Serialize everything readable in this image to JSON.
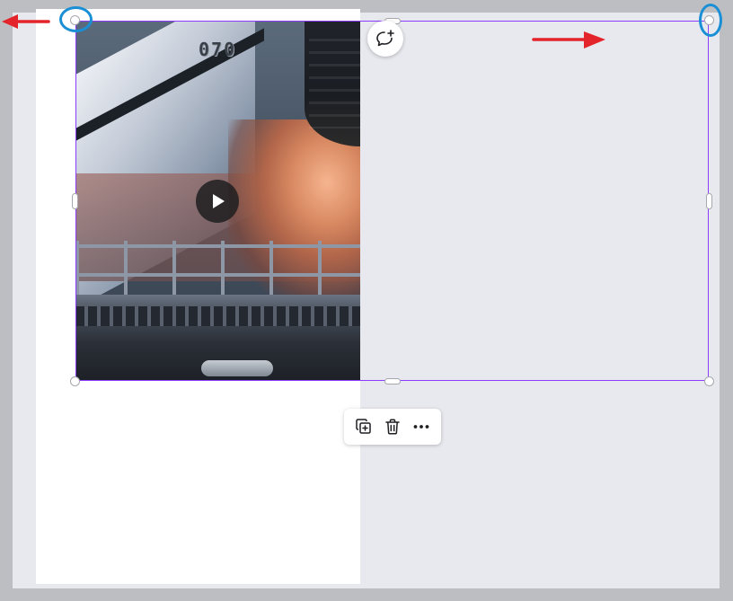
{
  "canvas": {
    "video": {
      "overlay_text": "070",
      "play_icon": "play-icon"
    },
    "selection": {
      "color": "#8b3dff"
    },
    "comment_button": {
      "icon": "add-comment-icon"
    },
    "toolbar": {
      "buttons": [
        {
          "icon": "duplicate-icon"
        },
        {
          "icon": "trash-icon"
        },
        {
          "icon": "more-icon"
        }
      ]
    }
  },
  "annotations": {
    "ring_color": "#1a8fd6",
    "arrow_color": "#e3242b"
  }
}
